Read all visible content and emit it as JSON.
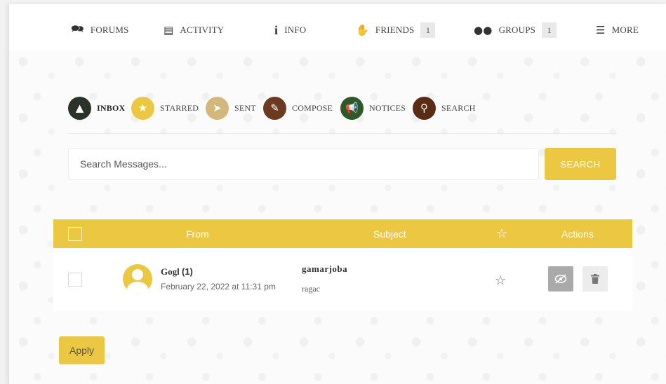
{
  "topnav": {
    "items": [
      {
        "label": "FORUMS",
        "icon": "forums-icon"
      },
      {
        "label": "ACTIVITY",
        "icon": "activity-icon"
      },
      {
        "label": "INFO",
        "icon": "info-icon"
      },
      {
        "label": "FRIENDS",
        "icon": "friends-icon",
        "count": "1"
      },
      {
        "label": "GROUPS",
        "icon": "groups-icon",
        "count": "1"
      },
      {
        "label": "MORE",
        "icon": "menu-icon"
      }
    ]
  },
  "tabs": [
    {
      "label": "INBOX",
      "color": "#2b3328",
      "icon": "inbox-icon",
      "active": true
    },
    {
      "label": "STARRED",
      "color": "#ecc741",
      "icon": "star-icon"
    },
    {
      "label": "SENT",
      "color": "#d4b77a",
      "icon": "send-icon"
    },
    {
      "label": "COMPOSE",
      "color": "#6b3a1f",
      "icon": "compose-icon"
    },
    {
      "label": "NOTICES",
      "color": "#2e5a2a",
      "icon": "megaphone-icon"
    },
    {
      "label": "SEARCH",
      "color": "#5a2c16",
      "icon": "search-icon"
    }
  ],
  "search": {
    "placeholder": "Search Messages...",
    "button_label": "SEARCH"
  },
  "table": {
    "headers": {
      "from": "From",
      "subject": "Subject",
      "actions": "Actions"
    },
    "rows": [
      {
        "sender": "Gogl",
        "count": "(1)",
        "date": "February 22, 2022 at 11:31 pm",
        "subject": "gamarjoba",
        "excerpt": "ragac"
      }
    ]
  },
  "apply_label": "Apply",
  "colors": {
    "accent": "#ecc741",
    "text": "#444444"
  }
}
